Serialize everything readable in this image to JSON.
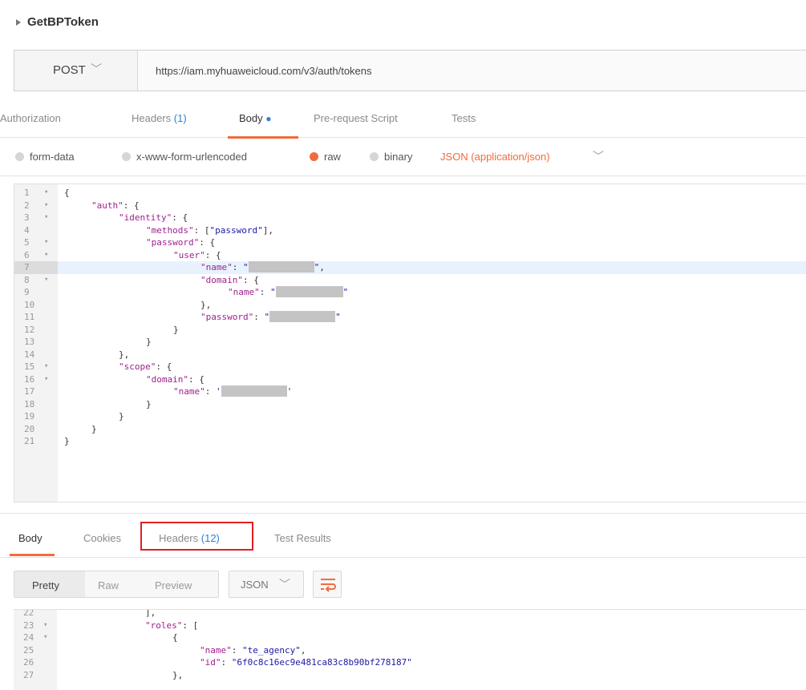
{
  "request": {
    "name": "GetBPToken",
    "method": "POST",
    "url": "https://iam.myhuaweicloud.com/v3/auth/tokens"
  },
  "request_tabs": [
    {
      "label": "Authorization",
      "count": "",
      "active": false
    },
    {
      "label": "Headers",
      "count": "(1)",
      "active": false
    },
    {
      "label": "Body",
      "count": "",
      "active": true
    },
    {
      "label": "Pre-request Script",
      "count": "",
      "active": false
    },
    {
      "label": "Tests",
      "count": "",
      "active": false
    }
  ],
  "body_types": [
    {
      "label": "form-data",
      "selected": false
    },
    {
      "label": "x-www-form-urlencoded",
      "selected": false
    },
    {
      "label": "raw",
      "selected": true
    },
    {
      "label": "binary",
      "selected": false
    }
  ],
  "content_type": "JSON (application/json)",
  "request_body_lines": [
    {
      "n": "1",
      "fold": true,
      "indent": 0,
      "tokens": [
        {
          "t": "p",
          "v": "{"
        }
      ]
    },
    {
      "n": "2",
      "fold": true,
      "indent": 1,
      "tokens": [
        {
          "t": "k",
          "v": "\"auth\""
        },
        {
          "t": "p",
          "v": ": {"
        }
      ]
    },
    {
      "n": "3",
      "fold": true,
      "indent": 2,
      "tokens": [
        {
          "t": "k",
          "v": "\"identity\""
        },
        {
          "t": "p",
          "v": ": {"
        }
      ]
    },
    {
      "n": "4",
      "fold": false,
      "indent": 3,
      "tokens": [
        {
          "t": "k",
          "v": "\"methods\""
        },
        {
          "t": "p",
          "v": ": ["
        },
        {
          "t": "s",
          "v": "\"password\""
        },
        {
          "t": "p",
          "v": "],"
        }
      ]
    },
    {
      "n": "5",
      "fold": true,
      "indent": 3,
      "tokens": [
        {
          "t": "k",
          "v": "\"password\""
        },
        {
          "t": "p",
          "v": ": {"
        }
      ]
    },
    {
      "n": "6",
      "fold": true,
      "indent": 4,
      "tokens": [
        {
          "t": "k",
          "v": "\"user\""
        },
        {
          "t": "p",
          "v": ": {"
        }
      ]
    },
    {
      "n": "7",
      "fold": false,
      "indent": 5,
      "highlight": true,
      "tokens": [
        {
          "t": "k",
          "v": "\"name\""
        },
        {
          "t": "p",
          "v": ": "
        },
        {
          "t": "s",
          "v": "\""
        },
        {
          "t": "r",
          "v": "82"
        },
        {
          "t": "s",
          "v": "\""
        },
        {
          "t": "p",
          "v": ","
        }
      ]
    },
    {
      "n": "8",
      "fold": true,
      "indent": 5,
      "tokens": [
        {
          "t": "k",
          "v": "\"domain\""
        },
        {
          "t": "p",
          "v": ": {"
        }
      ]
    },
    {
      "n": "9",
      "fold": false,
      "indent": 6,
      "tokens": [
        {
          "t": "k",
          "v": "\"name\""
        },
        {
          "t": "p",
          "v": ": "
        },
        {
          "t": "s",
          "v": "\""
        },
        {
          "t": "r",
          "v": "84"
        },
        {
          "t": "s",
          "v": "\""
        }
      ]
    },
    {
      "n": "10",
      "fold": false,
      "indent": 5,
      "tokens": [
        {
          "t": "p",
          "v": "},"
        }
      ]
    },
    {
      "n": "11",
      "fold": false,
      "indent": 5,
      "tokens": [
        {
          "t": "k",
          "v": "\"password\""
        },
        {
          "t": "p",
          "v": ": "
        },
        {
          "t": "s",
          "v": "\""
        },
        {
          "t": "r",
          "v": "82"
        },
        {
          "t": "s",
          "v": "\""
        }
      ]
    },
    {
      "n": "12",
      "fold": false,
      "indent": 4,
      "tokens": [
        {
          "t": "p",
          "v": "}"
        }
      ]
    },
    {
      "n": "13",
      "fold": false,
      "indent": 3,
      "tokens": [
        {
          "t": "p",
          "v": "}"
        }
      ]
    },
    {
      "n": "14",
      "fold": false,
      "indent": 2,
      "tokens": [
        {
          "t": "p",
          "v": "},"
        }
      ]
    },
    {
      "n": "15",
      "fold": true,
      "indent": 2,
      "tokens": [
        {
          "t": "k",
          "v": "\"scope\""
        },
        {
          "t": "p",
          "v": ": {"
        }
      ]
    },
    {
      "n": "16",
      "fold": true,
      "indent": 3,
      "tokens": [
        {
          "t": "k",
          "v": "\"domain\""
        },
        {
          "t": "p",
          "v": ": {"
        }
      ]
    },
    {
      "n": "17",
      "fold": false,
      "indent": 4,
      "tokens": [
        {
          "t": "k",
          "v": "\"name\""
        },
        {
          "t": "p",
          "v": ": "
        },
        {
          "t": "s",
          "v": "'"
        },
        {
          "t": "r",
          "v": "82"
        },
        {
          "t": "s",
          "v": "'"
        }
      ]
    },
    {
      "n": "18",
      "fold": false,
      "indent": 3,
      "tokens": [
        {
          "t": "p",
          "v": "}"
        }
      ]
    },
    {
      "n": "19",
      "fold": false,
      "indent": 2,
      "tokens": [
        {
          "t": "p",
          "v": "}"
        }
      ]
    },
    {
      "n": "20",
      "fold": false,
      "indent": 1,
      "tokens": [
        {
          "t": "p",
          "v": "}"
        }
      ]
    },
    {
      "n": "21",
      "fold": false,
      "indent": 0,
      "tokens": [
        {
          "t": "p",
          "v": "}"
        }
      ]
    }
  ],
  "response_tabs": [
    {
      "label": "Body",
      "count": "",
      "active": true
    },
    {
      "label": "Cookies",
      "count": "",
      "active": false
    },
    {
      "label": "Headers",
      "count": "(12)",
      "active": false,
      "outlined": true
    },
    {
      "label": "Test Results",
      "count": "",
      "active": false
    }
  ],
  "response_views": [
    {
      "label": "Pretty",
      "active": true
    },
    {
      "label": "Raw",
      "active": false
    },
    {
      "label": "Preview",
      "active": false
    }
  ],
  "response_format": "JSON",
  "response_body_lines": [
    {
      "n": "22",
      "fold": false,
      "indent": 3,
      "tokens": [
        {
          "t": "p",
          "v": "],"
        }
      ]
    },
    {
      "n": "23",
      "fold": true,
      "indent": 3,
      "tokens": [
        {
          "t": "k",
          "v": "\"roles\""
        },
        {
          "t": "p",
          "v": ": ["
        }
      ]
    },
    {
      "n": "24",
      "fold": true,
      "indent": 4,
      "tokens": [
        {
          "t": "p",
          "v": "{"
        }
      ]
    },
    {
      "n": "25",
      "fold": false,
      "indent": 5,
      "tokens": [
        {
          "t": "k",
          "v": "\"name\""
        },
        {
          "t": "p",
          "v": ": "
        },
        {
          "t": "s",
          "v": "\"te_agency\""
        },
        {
          "t": "p",
          "v": ","
        }
      ]
    },
    {
      "n": "26",
      "fold": false,
      "indent": 5,
      "tokens": [
        {
          "t": "k",
          "v": "\"id\""
        },
        {
          "t": "p",
          "v": ": "
        },
        {
          "t": "s",
          "v": "\"6f0c8c16ec9e481ca83c8b90bf278187\""
        }
      ]
    },
    {
      "n": "27",
      "fold": false,
      "indent": 4,
      "tokens": [
        {
          "t": "p",
          "v": "},"
        }
      ]
    }
  ],
  "icons": {
    "title_caret": "caret-right-icon",
    "method_chevron": "chevron-down-icon",
    "content_type_chevron": "chevron-down-icon",
    "format_chevron": "chevron-down-icon",
    "wrap": "wrap-lines-icon"
  },
  "colors": {
    "accent": "#f26b3a",
    "count_blue": "#2b7fd4",
    "highlight_outline": "#e02020"
  }
}
